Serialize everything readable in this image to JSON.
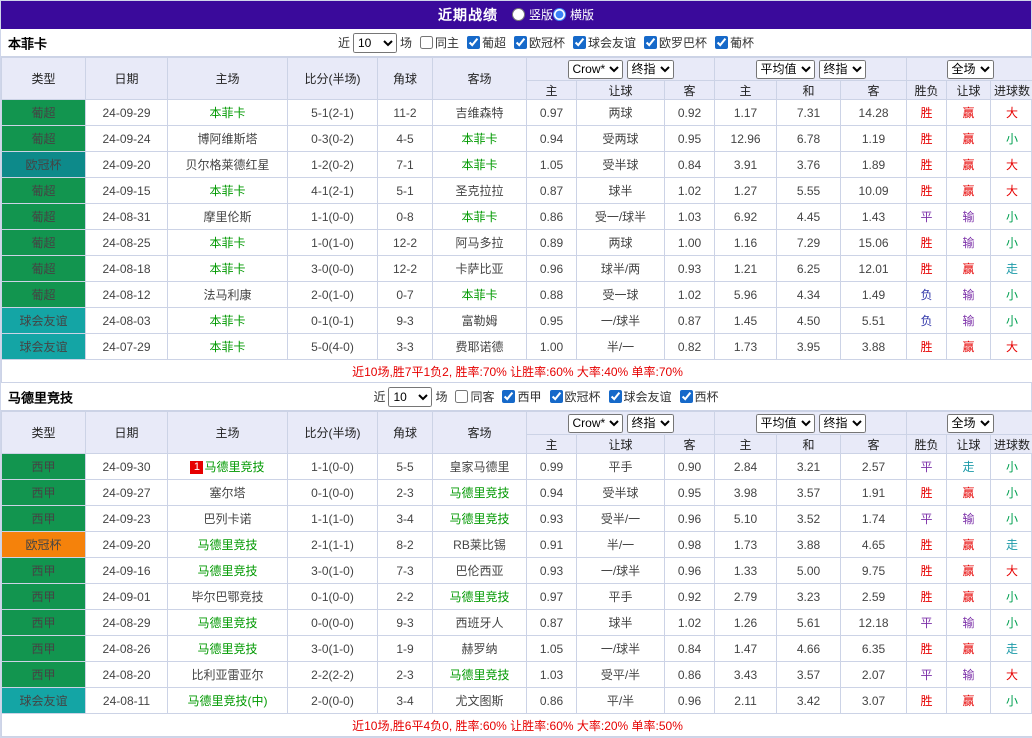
{
  "colors": {
    "page_border": "#cfd6ea",
    "topbar_bg": "#3a0a9b",
    "header_bg": "#e8eaf8",
    "grid_border": "#ccd3e6",
    "focal_team": "#009900",
    "score": "#e8356a",
    "summary": "#e60000",
    "rank_bg": "#e60000",
    "radio_accent": "#3b82f6"
  },
  "result_colors": {
    "胜": "#e60000",
    "平": "#7b2fa8",
    "负": "#2f35a8",
    "赢": "#e60000",
    "输": "#7b2fa8",
    "走": "#1d9aa8",
    "大": "#e60000",
    "小": "#00a050"
  },
  "topbar": {
    "title": "近期战绩",
    "radios": [
      {
        "label": "竖版",
        "checked": false
      },
      {
        "label": "横版",
        "checked": true
      }
    ]
  },
  "table_header": {
    "left_columns": [
      "类型",
      "日期",
      "主场",
      "比分(半场)",
      "角球",
      "客场"
    ],
    "select_groups": [
      [
        "Crow*",
        "终指"
      ],
      [
        "平均值",
        "终指"
      ],
      [
        "全场"
      ]
    ],
    "sub_columns": [
      "主",
      "让球",
      "客",
      "主",
      "和",
      "客",
      "胜负",
      "让球",
      "进球数"
    ]
  },
  "sections": [
    {
      "team": "本菲卡",
      "filter": {
        "prefix": "近",
        "count": "10",
        "suffix": "场",
        "same": {
          "label": "同主",
          "checked": false
        },
        "leagues": [
          {
            "label": "葡超",
            "checked": true
          },
          {
            "label": "欧冠杯",
            "checked": true
          },
          {
            "label": "球会友谊",
            "checked": true
          },
          {
            "label": "欧罗巴杯",
            "checked": true
          },
          {
            "label": "葡杯",
            "checked": true
          }
        ]
      },
      "rows": [
        {
          "league": "葡超",
          "league_color": "#12954f",
          "date": "24-09-29",
          "rank": "",
          "home": "本菲卡",
          "home_focal": true,
          "score": "5-1(2-1)",
          "corners": "11-2",
          "away": "吉维森特",
          "away_focal": false,
          "odds": [
            "0.97",
            "两球",
            "0.92"
          ],
          "avg": [
            "1.17",
            "7.31",
            "14.28"
          ],
          "results": [
            "胜",
            "赢",
            "大"
          ]
        },
        {
          "league": "葡超",
          "league_color": "#12954f",
          "date": "24-09-24",
          "rank": "",
          "home": "博阿维斯塔",
          "home_focal": false,
          "score": "0-3(0-2)",
          "corners": "4-5",
          "away": "本菲卡",
          "away_focal": true,
          "odds": [
            "0.94",
            "受两球",
            "0.95"
          ],
          "avg": [
            "12.96",
            "6.78",
            "1.19"
          ],
          "results": [
            "胜",
            "赢",
            "小"
          ]
        },
        {
          "league": "欧冠杯",
          "league_color": "#0d8a8a",
          "date": "24-09-20",
          "rank": "",
          "home": "贝尔格莱德红星",
          "home_focal": false,
          "score": "1-2(0-2)",
          "corners": "7-1",
          "away": "本菲卡",
          "away_focal": true,
          "odds": [
            "1.05",
            "受半球",
            "0.84"
          ],
          "avg": [
            "3.91",
            "3.76",
            "1.89"
          ],
          "results": [
            "胜",
            "赢",
            "大"
          ]
        },
        {
          "league": "葡超",
          "league_color": "#12954f",
          "date": "24-09-15",
          "rank": "",
          "home": "本菲卡",
          "home_focal": true,
          "score": "4-1(2-1)",
          "corners": "5-1",
          "away": "圣克拉拉",
          "away_focal": false,
          "odds": [
            "0.87",
            "球半",
            "1.02"
          ],
          "avg": [
            "1.27",
            "5.55",
            "10.09"
          ],
          "results": [
            "胜",
            "赢",
            "大"
          ]
        },
        {
          "league": "葡超",
          "league_color": "#12954f",
          "date": "24-08-31",
          "rank": "",
          "home": "摩里伦斯",
          "home_focal": false,
          "score": "1-1(0-0)",
          "corners": "0-8",
          "away": "本菲卡",
          "away_focal": true,
          "odds": [
            "0.86",
            "受一/球半",
            "1.03"
          ],
          "avg": [
            "6.92",
            "4.45",
            "1.43"
          ],
          "results": [
            "平",
            "输",
            "小"
          ]
        },
        {
          "league": "葡超",
          "league_color": "#12954f",
          "date": "24-08-25",
          "rank": "",
          "home": "本菲卡",
          "home_focal": true,
          "score": "1-0(1-0)",
          "corners": "12-2",
          "away": "阿马多拉",
          "away_focal": false,
          "odds": [
            "0.89",
            "两球",
            "1.00"
          ],
          "avg": [
            "1.16",
            "7.29",
            "15.06"
          ],
          "results": [
            "胜",
            "输",
            "小"
          ]
        },
        {
          "league": "葡超",
          "league_color": "#12954f",
          "date": "24-08-18",
          "rank": "",
          "home": "本菲卡",
          "home_focal": true,
          "score": "3-0(0-0)",
          "corners": "12-2",
          "away": "卡萨比亚",
          "away_focal": false,
          "odds": [
            "0.96",
            "球半/两",
            "0.93"
          ],
          "avg": [
            "1.21",
            "6.25",
            "12.01"
          ],
          "results": [
            "胜",
            "赢",
            "走"
          ]
        },
        {
          "league": "葡超",
          "league_color": "#12954f",
          "date": "24-08-12",
          "rank": "",
          "home": "法马利康",
          "home_focal": false,
          "score": "2-0(1-0)",
          "corners": "0-7",
          "away": "本菲卡",
          "away_focal": true,
          "odds": [
            "0.88",
            "受一球",
            "1.02"
          ],
          "avg": [
            "5.96",
            "4.34",
            "1.49"
          ],
          "results": [
            "负",
            "输",
            "小"
          ]
        },
        {
          "league": "球会友谊",
          "league_color": "#14a5a5",
          "date": "24-08-03",
          "rank": "",
          "home": "本菲卡",
          "home_focal": true,
          "score": "0-1(0-1)",
          "corners": "9-3",
          "away": "富勒姆",
          "away_focal": false,
          "odds": [
            "0.95",
            "一/球半",
            "0.87"
          ],
          "avg": [
            "1.45",
            "4.50",
            "5.51"
          ],
          "results": [
            "负",
            "输",
            "小"
          ]
        },
        {
          "league": "球会友谊",
          "league_color": "#14a5a5",
          "date": "24-07-29",
          "rank": "",
          "home": "本菲卡",
          "home_focal": true,
          "score": "5-0(4-0)",
          "corners": "3-3",
          "away": "费耶诺德",
          "away_focal": false,
          "odds": [
            "1.00",
            "半/一",
            "0.82"
          ],
          "avg": [
            "1.73",
            "3.95",
            "3.88"
          ],
          "results": [
            "胜",
            "赢",
            "大"
          ]
        }
      ],
      "summary": "近10场,胜7平1负2, 胜率:70% 让胜率:60% 大率:40% 单率:70%"
    },
    {
      "team": "马德里竞技",
      "filter": {
        "prefix": "近",
        "count": "10",
        "suffix": "场",
        "same": {
          "label": "同客",
          "checked": false
        },
        "leagues": [
          {
            "label": "西甲",
            "checked": true
          },
          {
            "label": "欧冠杯",
            "checked": true
          },
          {
            "label": "球会友谊",
            "checked": true
          },
          {
            "label": "西杯",
            "checked": true
          }
        ]
      },
      "rows": [
        {
          "league": "西甲",
          "league_color": "#12954f",
          "date": "24-09-30",
          "rank": "1",
          "home": "马德里竞技",
          "home_focal": true,
          "score": "1-1(0-0)",
          "corners": "5-5",
          "away": "皇家马德里",
          "away_focal": false,
          "odds": [
            "0.99",
            "平手",
            "0.90"
          ],
          "avg": [
            "2.84",
            "3.21",
            "2.57"
          ],
          "results": [
            "平",
            "走",
            "小"
          ]
        },
        {
          "league": "西甲",
          "league_color": "#12954f",
          "date": "24-09-27",
          "rank": "",
          "home": "塞尔塔",
          "home_focal": false,
          "score": "0-1(0-0)",
          "corners": "2-3",
          "away": "马德里竞技",
          "away_focal": true,
          "odds": [
            "0.94",
            "受半球",
            "0.95"
          ],
          "avg": [
            "3.98",
            "3.57",
            "1.91"
          ],
          "results": [
            "胜",
            "赢",
            "小"
          ]
        },
        {
          "league": "西甲",
          "league_color": "#12954f",
          "date": "24-09-23",
          "rank": "",
          "home": "巴列卡诺",
          "home_focal": false,
          "score": "1-1(1-0)",
          "corners": "3-4",
          "away": "马德里竞技",
          "away_focal": true,
          "odds": [
            "0.93",
            "受半/一",
            "0.96"
          ],
          "avg": [
            "5.10",
            "3.52",
            "1.74"
          ],
          "results": [
            "平",
            "输",
            "小"
          ]
        },
        {
          "league": "欧冠杯",
          "league_color": "#f5820b",
          "date": "24-09-20",
          "rank": "",
          "home": "马德里竞技",
          "home_focal": true,
          "score": "2-1(1-1)",
          "corners": "8-2",
          "away": "RB莱比锡",
          "away_focal": false,
          "odds": [
            "0.91",
            "半/一",
            "0.98"
          ],
          "avg": [
            "1.73",
            "3.88",
            "4.65"
          ],
          "results": [
            "胜",
            "赢",
            "走"
          ]
        },
        {
          "league": "西甲",
          "league_color": "#12954f",
          "date": "24-09-16",
          "rank": "",
          "home": "马德里竞技",
          "home_focal": true,
          "score": "3-0(1-0)",
          "corners": "7-3",
          "away": "巴伦西亚",
          "away_focal": false,
          "odds": [
            "0.93",
            "一/球半",
            "0.96"
          ],
          "avg": [
            "1.33",
            "5.00",
            "9.75"
          ],
          "results": [
            "胜",
            "赢",
            "大"
          ]
        },
        {
          "league": "西甲",
          "league_color": "#12954f",
          "date": "24-09-01",
          "rank": "",
          "home": "毕尔巴鄂竞技",
          "home_focal": false,
          "score": "0-1(0-0)",
          "corners": "2-2",
          "away": "马德里竞技",
          "away_focal": true,
          "odds": [
            "0.97",
            "平手",
            "0.92"
          ],
          "avg": [
            "2.79",
            "3.23",
            "2.59"
          ],
          "results": [
            "胜",
            "赢",
            "小"
          ]
        },
        {
          "league": "西甲",
          "league_color": "#12954f",
          "date": "24-08-29",
          "rank": "",
          "home": "马德里竞技",
          "home_focal": true,
          "score": "0-0(0-0)",
          "corners": "9-3",
          "away": "西班牙人",
          "away_focal": false,
          "odds": [
            "0.87",
            "球半",
            "1.02"
          ],
          "avg": [
            "1.26",
            "5.61",
            "12.18"
          ],
          "results": [
            "平",
            "输",
            "小"
          ]
        },
        {
          "league": "西甲",
          "league_color": "#12954f",
          "date": "24-08-26",
          "rank": "",
          "home": "马德里竞技",
          "home_focal": true,
          "score": "3-0(1-0)",
          "corners": "1-9",
          "away": "赫罗纳",
          "away_focal": false,
          "odds": [
            "1.05",
            "一/球半",
            "0.84"
          ],
          "avg": [
            "1.47",
            "4.66",
            "6.35"
          ],
          "results": [
            "胜",
            "赢",
            "走"
          ]
        },
        {
          "league": "西甲",
          "league_color": "#12954f",
          "date": "24-08-20",
          "rank": "",
          "home": "比利亚雷亚尔",
          "home_focal": false,
          "score": "2-2(2-2)",
          "corners": "2-3",
          "away": "马德里竞技",
          "away_focal": true,
          "odds": [
            "1.03",
            "受平/半",
            "0.86"
          ],
          "avg": [
            "3.43",
            "3.57",
            "2.07"
          ],
          "results": [
            "平",
            "输",
            "大"
          ]
        },
        {
          "league": "球会友谊",
          "league_color": "#14a5a5",
          "date": "24-08-11",
          "rank": "",
          "home": "马德里竞技(中)",
          "home_focal": true,
          "score": "2-0(0-0)",
          "corners": "3-4",
          "away": "尤文图斯",
          "away_focal": false,
          "odds": [
            "0.86",
            "平/半",
            "0.96"
          ],
          "avg": [
            "2.11",
            "3.42",
            "3.07"
          ],
          "results": [
            "胜",
            "赢",
            "小"
          ]
        }
      ],
      "summary": "近10场,胜6平4负0, 胜率:60% 让胜率:60% 大率:20% 单率:50%"
    }
  ]
}
